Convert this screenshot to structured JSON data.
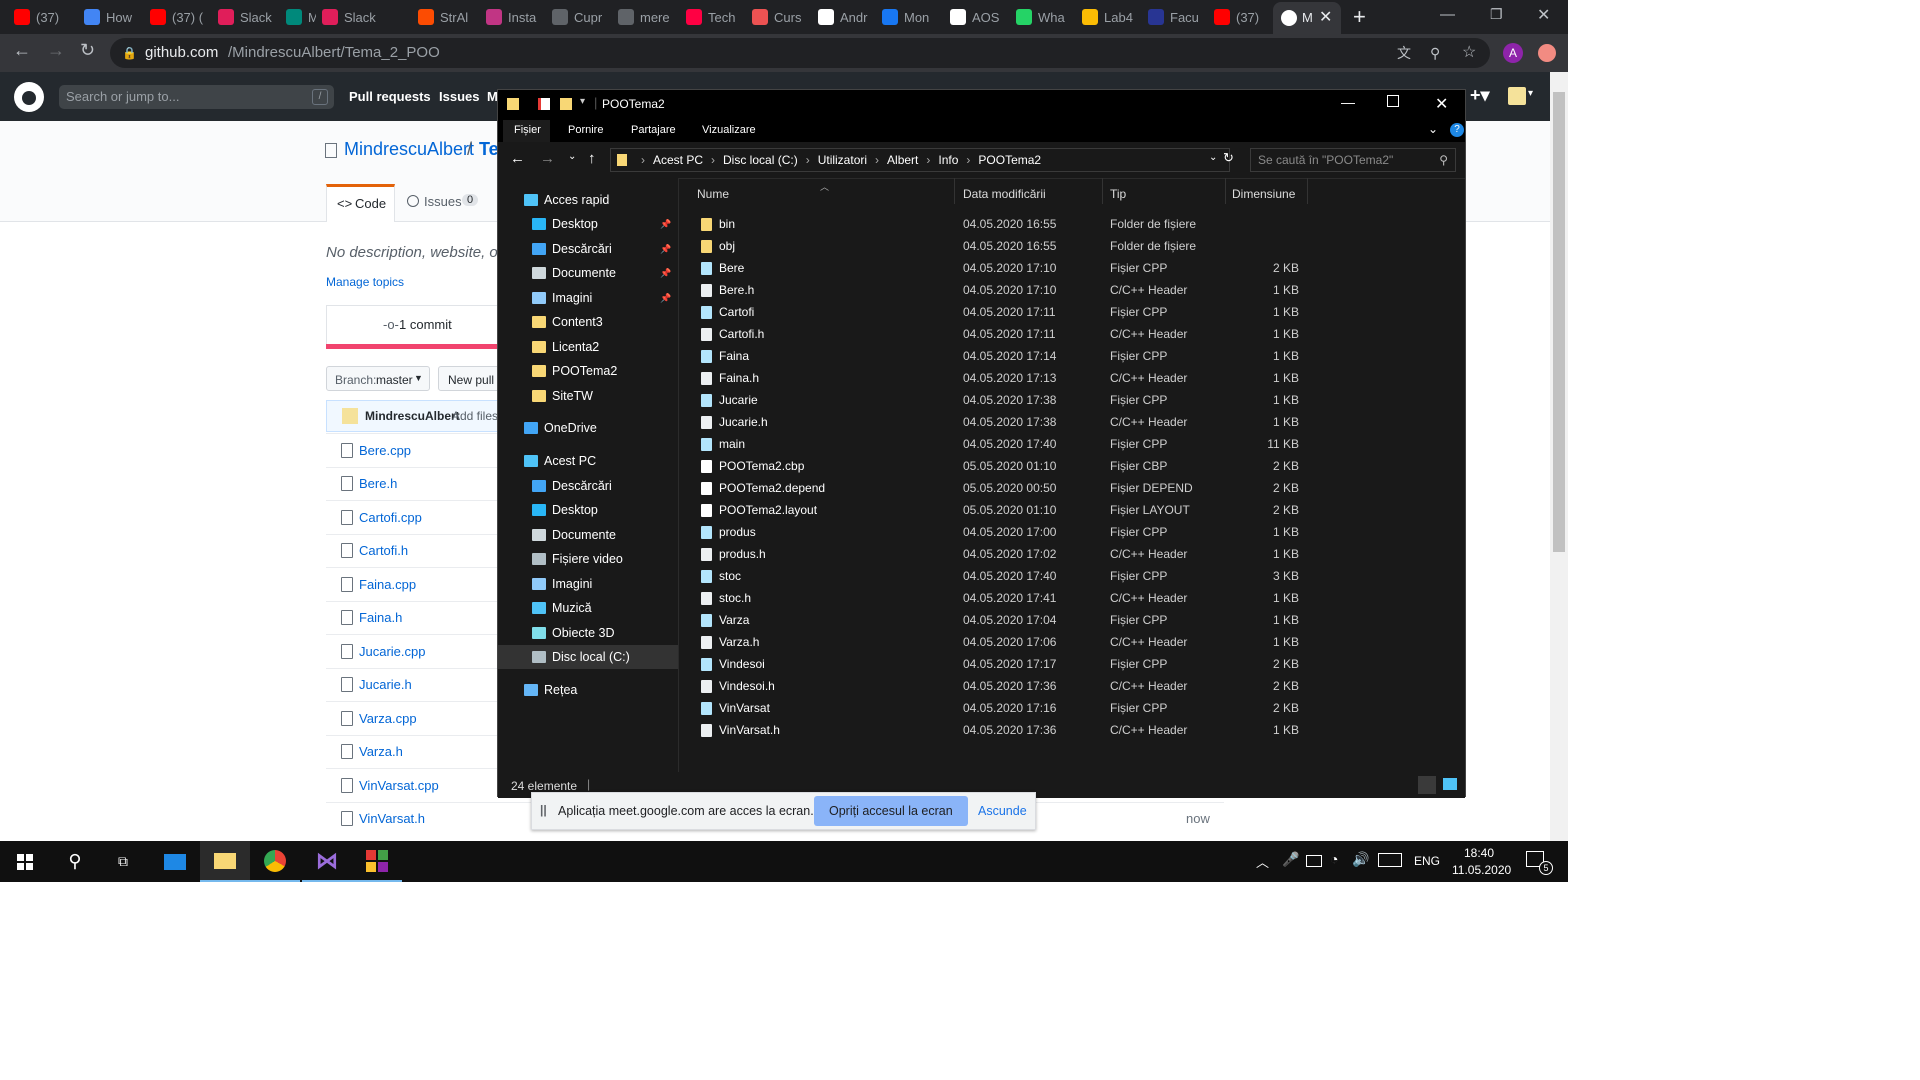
{
  "browser": {
    "tabs": [
      {
        "title": "(37)",
        "icon": "youtube-icon",
        "color": "#ff0000"
      },
      {
        "title": "How",
        "icon": "c-icon",
        "color": "#4285f4"
      },
      {
        "title": "(37) (",
        "icon": "youtube-icon",
        "color": "#ff0000"
      },
      {
        "title": "Slack",
        "icon": "slack-icon",
        "color": "#e01e5a"
      },
      {
        "title": "M",
        "icon": "meet-icon",
        "color": "#00897b"
      },
      {
        "title": "Slack",
        "icon": "slack-icon",
        "color": "#e01e5a"
      },
      {
        "title": "StrAl",
        "icon": "strava-icon",
        "color": "#fc4c02"
      },
      {
        "title": "Insta",
        "icon": "instagram-icon",
        "color": "#c13584"
      },
      {
        "title": "Cupr",
        "icon": "globe-icon",
        "color": "#5f6368"
      },
      {
        "title": "mere",
        "icon": "globe-icon",
        "color": "#5f6368"
      },
      {
        "title": "Tech",
        "icon": "play-icon",
        "color": "#ff0043"
      },
      {
        "title": "Curs",
        "icon": "u-icon",
        "color": "#ec5252"
      },
      {
        "title": "Andr",
        "icon": "github-icon",
        "color": "#ffffff"
      },
      {
        "title": "Mon",
        "icon": "f-icon",
        "color": "#1877f2"
      },
      {
        "title": "AOS",
        "icon": "globe-icon",
        "color": "#ffffff"
      },
      {
        "title": "Wha",
        "icon": "whatsapp-icon",
        "color": "#25d366"
      },
      {
        "title": "Lab4",
        "icon": "drive-icon",
        "color": "#fbbc04"
      },
      {
        "title": "Facu",
        "icon": "fi-icon",
        "color": "#283593"
      },
      {
        "title": "(37)",
        "icon": "youtube-icon",
        "color": "#ff0000"
      }
    ],
    "active_tab": "M",
    "url_host": "github.com",
    "url_path": "/MindrescuAlbert/Tema_2_POO",
    "profile_initial": "A"
  },
  "github": {
    "search_placeholder": "Search or jump to...",
    "search_key": "/",
    "nav": [
      "Pull requests",
      "Issues",
      "M"
    ],
    "repo_owner": "MindrescuAlbert",
    "repo_sep": "/",
    "repo_name_partial": "Te",
    "tab_code": "Code",
    "tab_issues": "Issues",
    "issues_count": "0",
    "description": "No description, website, or",
    "manage_topics": "Manage topics",
    "commits": "1 commit",
    "branch_label": "Branch:",
    "branch_name": "master",
    "new_pull": "New pull",
    "commit_author": "MindrescuAlbert",
    "commit_msg": "Add files",
    "last_time": "now",
    "files": [
      "Bere.cpp",
      "Bere.h",
      "Cartofi.cpp",
      "Cartofi.h",
      "Faina.cpp",
      "Faina.h",
      "Jucarie.cpp",
      "Jucarie.h",
      "Varza.cpp",
      "Varza.h",
      "VinVarsat.cpp",
      "VinVarsat.h"
    ]
  },
  "explorer": {
    "title": "POOTema2",
    "ribbon": [
      "Fișier",
      "Pornire",
      "Partajare",
      "Vizualizare"
    ],
    "breadcrumbs": [
      "Acest PC",
      "Disc local (C:)",
      "Utilizatori",
      "Albert",
      "Info",
      "POOTema2"
    ],
    "search_placeholder": "Se caută în \"POOTema2\"",
    "columns": {
      "name": "Nume",
      "date": "Data modificării",
      "type": "Tip",
      "size": "Dimensiune"
    },
    "nav": [
      {
        "label": "Acces rapid",
        "icon": "star-icon",
        "level": 0,
        "pinned": false
      },
      {
        "label": "Desktop",
        "icon": "desktop-icon",
        "level": 1,
        "pinned": true
      },
      {
        "label": "Descărcări",
        "icon": "download-icon",
        "level": 1,
        "pinned": true
      },
      {
        "label": "Documente",
        "icon": "documents-icon",
        "level": 1,
        "pinned": true
      },
      {
        "label": "Imagini",
        "icon": "pictures-icon",
        "level": 1,
        "pinned": true
      },
      {
        "label": "Content3",
        "icon": "folder-icon",
        "level": 1,
        "pinned": false
      },
      {
        "label": "Licenta2",
        "icon": "folder-icon",
        "level": 1,
        "pinned": false
      },
      {
        "label": "POOTema2",
        "icon": "folder-icon",
        "level": 1,
        "pinned": false
      },
      {
        "label": "SiteTW",
        "icon": "folder-icon",
        "level": 1,
        "pinned": false
      },
      {
        "label": "OneDrive",
        "icon": "cloud-icon",
        "level": 0,
        "pinned": false
      },
      {
        "label": "Acest PC",
        "icon": "pc-icon",
        "level": 0,
        "pinned": false
      },
      {
        "label": "Descărcări",
        "icon": "download-icon",
        "level": 1,
        "pinned": false
      },
      {
        "label": "Desktop",
        "icon": "desktop-icon",
        "level": 1,
        "pinned": false
      },
      {
        "label": "Documente",
        "icon": "documents-icon",
        "level": 1,
        "pinned": false
      },
      {
        "label": "Fișiere video",
        "icon": "video-icon",
        "level": 1,
        "pinned": false
      },
      {
        "label": "Imagini",
        "icon": "pictures-icon",
        "level": 1,
        "pinned": false
      },
      {
        "label": "Muzică",
        "icon": "music-icon",
        "level": 1,
        "pinned": false
      },
      {
        "label": "Obiecte 3D",
        "icon": "cube-icon",
        "level": 1,
        "pinned": false
      },
      {
        "label": "Disc local (C:)",
        "icon": "drive-icon",
        "level": 1,
        "pinned": false,
        "selected": true
      },
      {
        "label": "Rețea",
        "icon": "network-icon",
        "level": 0,
        "pinned": false
      }
    ],
    "files": [
      {
        "name": "bin",
        "date": "04.05.2020 16:55",
        "type": "Folder de fișiere",
        "size": "",
        "kind": "folder"
      },
      {
        "name": "obj",
        "date": "04.05.2020 16:55",
        "type": "Folder de fișiere",
        "size": "",
        "kind": "folder"
      },
      {
        "name": "Bere",
        "date": "04.05.2020 17:10",
        "type": "Fișier CPP",
        "size": "2 KB",
        "kind": "cpp"
      },
      {
        "name": "Bere.h",
        "date": "04.05.2020 17:10",
        "type": "C/C++ Header",
        "size": "1 KB",
        "kind": "h"
      },
      {
        "name": "Cartofi",
        "date": "04.05.2020 17:11",
        "type": "Fișier CPP",
        "size": "1 KB",
        "kind": "cpp"
      },
      {
        "name": "Cartofi.h",
        "date": "04.05.2020 17:11",
        "type": "C/C++ Header",
        "size": "1 KB",
        "kind": "h"
      },
      {
        "name": "Faina",
        "date": "04.05.2020 17:14",
        "type": "Fișier CPP",
        "size": "1 KB",
        "kind": "cpp"
      },
      {
        "name": "Faina.h",
        "date": "04.05.2020 17:13",
        "type": "C/C++ Header",
        "size": "1 KB",
        "kind": "h"
      },
      {
        "name": "Jucarie",
        "date": "04.05.2020 17:38",
        "type": "Fișier CPP",
        "size": "1 KB",
        "kind": "cpp"
      },
      {
        "name": "Jucarie.h",
        "date": "04.05.2020 17:38",
        "type": "C/C++ Header",
        "size": "1 KB",
        "kind": "h"
      },
      {
        "name": "main",
        "date": "04.05.2020 17:40",
        "type": "Fișier CPP",
        "size": "11 KB",
        "kind": "cpp"
      },
      {
        "name": "POOTema2.cbp",
        "date": "05.05.2020 01:10",
        "type": "Fișier CBP",
        "size": "2 KB",
        "kind": "doc"
      },
      {
        "name": "POOTema2.depend",
        "date": "05.05.2020 00:50",
        "type": "Fișier DEPEND",
        "size": "2 KB",
        "kind": "doc"
      },
      {
        "name": "POOTema2.layout",
        "date": "05.05.2020 01:10",
        "type": "Fișier LAYOUT",
        "size": "2 KB",
        "kind": "doc"
      },
      {
        "name": "produs",
        "date": "04.05.2020 17:00",
        "type": "Fișier CPP",
        "size": "1 KB",
        "kind": "cpp"
      },
      {
        "name": "produs.h",
        "date": "04.05.2020 17:02",
        "type": "C/C++ Header",
        "size": "1 KB",
        "kind": "h"
      },
      {
        "name": "stoc",
        "date": "04.05.2020 17:40",
        "type": "Fișier CPP",
        "size": "3 KB",
        "kind": "cpp"
      },
      {
        "name": "stoc.h",
        "date": "04.05.2020 17:41",
        "type": "C/C++ Header",
        "size": "1 KB",
        "kind": "h"
      },
      {
        "name": "Varza",
        "date": "04.05.2020 17:04",
        "type": "Fișier CPP",
        "size": "1 KB",
        "kind": "cpp"
      },
      {
        "name": "Varza.h",
        "date": "04.05.2020 17:06",
        "type": "C/C++ Header",
        "size": "1 KB",
        "kind": "h"
      },
      {
        "name": "Vindesoi",
        "date": "04.05.2020 17:17",
        "type": "Fișier CPP",
        "size": "2 KB",
        "kind": "cpp"
      },
      {
        "name": "Vindesoi.h",
        "date": "04.05.2020 17:36",
        "type": "C/C++ Header",
        "size": "2 KB",
        "kind": "h"
      },
      {
        "name": "VinVarsat",
        "date": "04.05.2020 17:16",
        "type": "Fișier CPP",
        "size": "2 KB",
        "kind": "cpp"
      },
      {
        "name": "VinVarsat.h",
        "date": "04.05.2020 17:36",
        "type": "C/C++ Header",
        "size": "1 KB",
        "kind": "h"
      }
    ],
    "status": "24 elemente"
  },
  "sharebar": {
    "message": "Aplicația meet.google.com are acces la ecran.",
    "stop_button": "Opriți accesul la ecran",
    "hide_button": "Ascunde"
  },
  "taskbar": {
    "language": "ENG",
    "time": "18:40",
    "date": "11.05.2020",
    "notifications": "5"
  }
}
